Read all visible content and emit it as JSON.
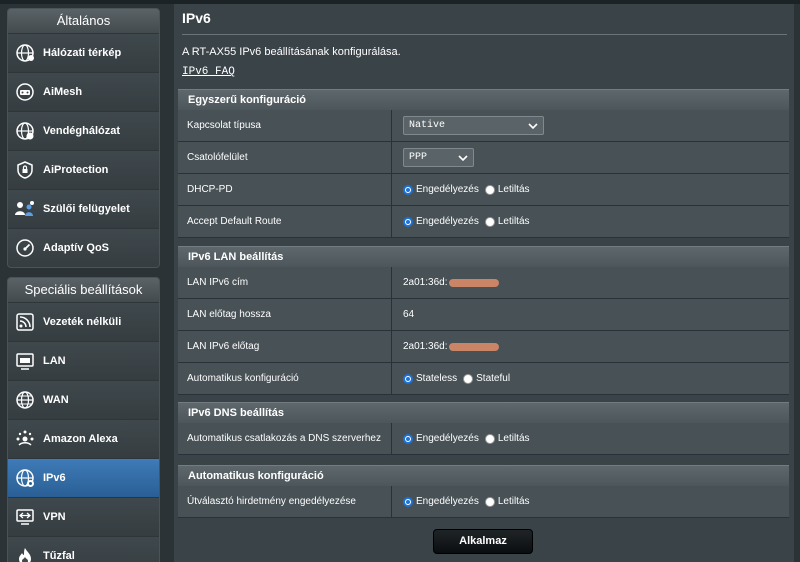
{
  "sidebar": {
    "general_title": "Általános",
    "general_items": [
      {
        "label": "Hálózati térkép",
        "icon": "globe-icon"
      },
      {
        "label": "AiMesh",
        "icon": "aimesh-icon"
      },
      {
        "label": "Vendéghálózat",
        "icon": "guest-network-icon"
      },
      {
        "label": "AiProtection",
        "icon": "shield-lock-icon"
      },
      {
        "label": "Szülői felügyelet",
        "icon": "parental-icon"
      },
      {
        "label": "Adaptív QoS",
        "icon": "gauge-icon"
      }
    ],
    "advanced_title": "Speciális beállítások",
    "advanced_items": [
      {
        "label": "Vezeték nélküli",
        "icon": "wifi-icon"
      },
      {
        "label": "LAN",
        "icon": "lan-icon"
      },
      {
        "label": "WAN",
        "icon": "globe-icon"
      },
      {
        "label": "Amazon Alexa",
        "icon": "alexa-icon"
      },
      {
        "label": "IPv6",
        "icon": "ipv6-globe-icon",
        "active": true
      },
      {
        "label": "VPN",
        "icon": "vpn-icon"
      },
      {
        "label": "Tűzfal",
        "icon": "fire-icon"
      }
    ]
  },
  "page": {
    "title": "IPv6",
    "description": "A RT-AX55 IPv6 beállításának konfigurálása.",
    "faq_link": "IPv6 FAQ"
  },
  "sections": {
    "basic": {
      "title": "Egyszerű konfiguráció",
      "connection_type_label": "Kapcsolat típusa",
      "connection_type_value": "Native",
      "interface_label": "Csatolófelület",
      "interface_value": "PPP",
      "dhcppd_label": "DHCP-PD",
      "accept_route_label": "Accept Default Route"
    },
    "lan": {
      "title": "IPv6 LAN beállítás",
      "lan_addr_label": "LAN IPv6 cím",
      "lan_addr_value": "2a01:36d:",
      "prefix_len_label": "LAN előtag hossza",
      "prefix_len_value": "64",
      "prefix_label": "LAN IPv6 előtag",
      "prefix_value": "2a01:36d:",
      "autoconf_label": "Automatikus konfiguráció",
      "stateless": "Stateless",
      "stateful": "Stateful"
    },
    "dns": {
      "title": "IPv6 DNS beállítás",
      "auto_dns_label": "Automatikus csatlakozás a DNS szerverhez"
    },
    "autoconf": {
      "title": "Automatikus konfiguráció",
      "router_adv_label": "Útválasztó hirdetmény engedélyezése"
    }
  },
  "options": {
    "enable": "Engedélyezés",
    "disable": "Letiltás"
  },
  "apply_label": "Alkalmaz",
  "colors": {
    "accent_blue": "#2a5f95",
    "radio_blue": "#1e73d8",
    "redaction": "#c98566"
  }
}
